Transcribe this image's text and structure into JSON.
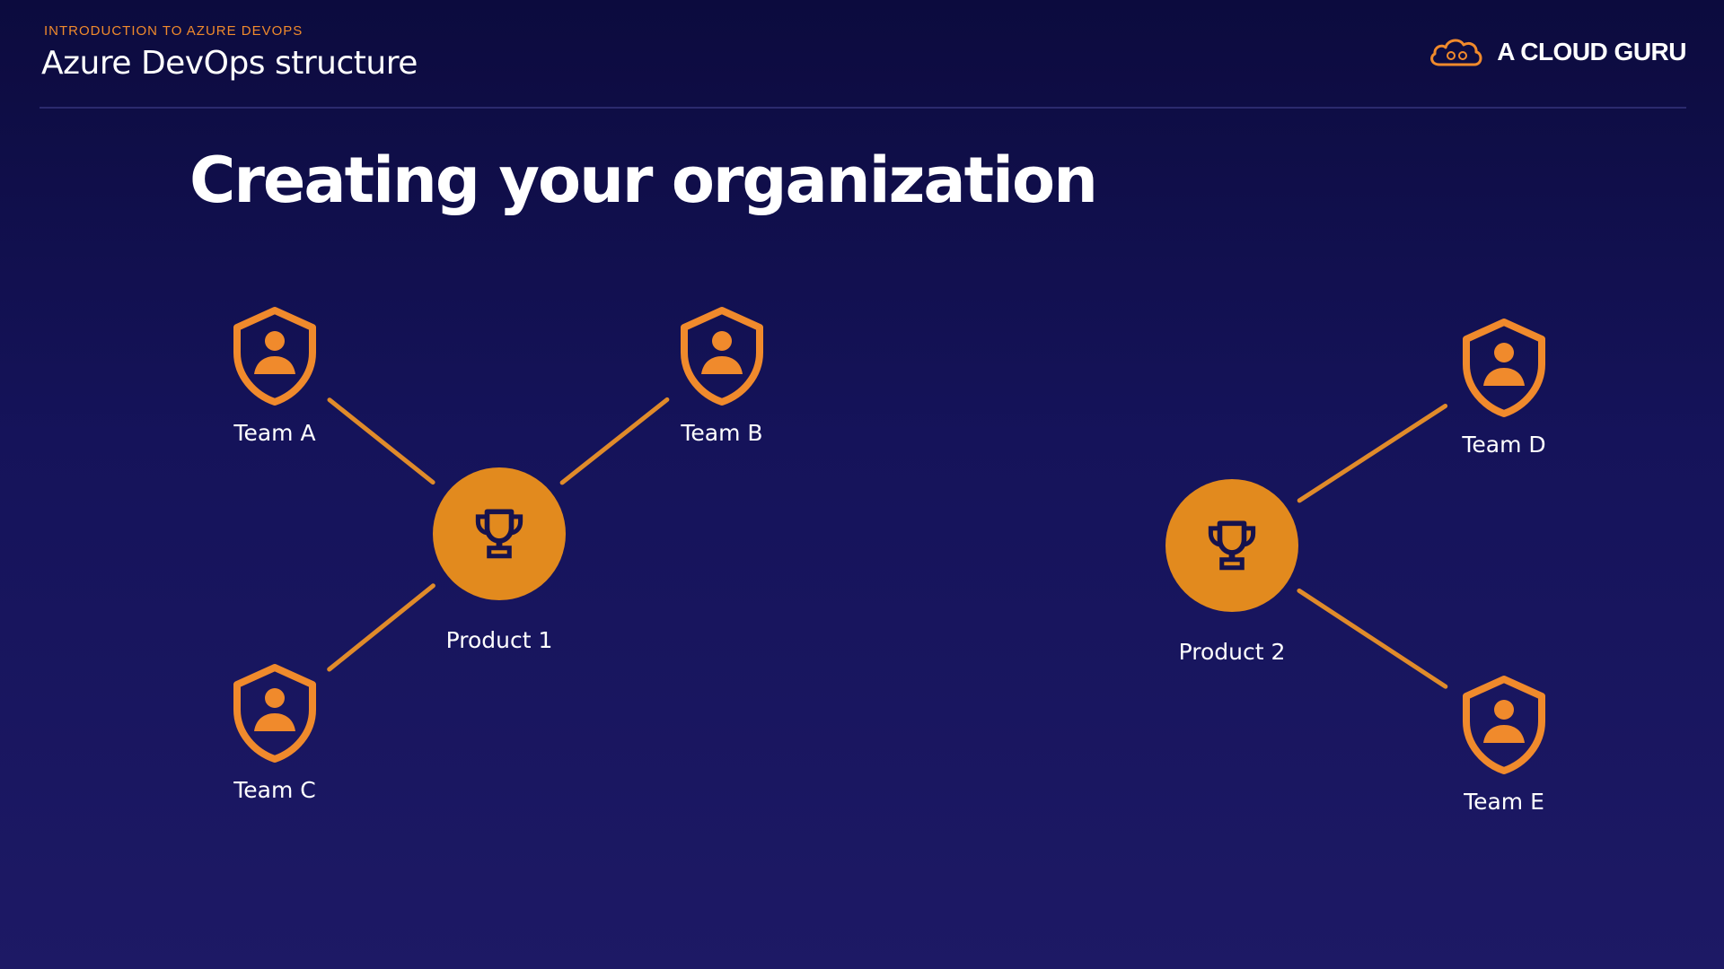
{
  "header": {
    "eyebrow": "INTRODUCTION TO AZURE DEVOPS",
    "section_title": "Azure DevOps structure",
    "brand_name": "A CLOUD GURU",
    "brand_icon": "cloud-logo-icon"
  },
  "main": {
    "title": "Creating your organization"
  },
  "colors": {
    "accent": "#f08a2c",
    "product_fill": "#e28a1e",
    "line": "#e08b2a",
    "background_top": "#0c0b3e",
    "background_bottom": "#1d1965"
  },
  "diagram": {
    "products": [
      {
        "id": "p1",
        "label": "Product 1",
        "icon": "trophy-icon"
      },
      {
        "id": "p2",
        "label": "Product 2",
        "icon": "trophy-icon"
      }
    ],
    "teams": [
      {
        "id": "ta",
        "label": "Team A",
        "product": "p1",
        "icon": "shield-user-icon"
      },
      {
        "id": "tb",
        "label": "Team B",
        "product": "p1",
        "icon": "shield-user-icon"
      },
      {
        "id": "tc",
        "label": "Team C",
        "product": "p1",
        "icon": "shield-user-icon"
      },
      {
        "id": "td",
        "label": "Team D",
        "product": "p2",
        "icon": "shield-user-icon"
      },
      {
        "id": "te",
        "label": "Team E",
        "product": "p2",
        "icon": "shield-user-icon"
      }
    ]
  }
}
